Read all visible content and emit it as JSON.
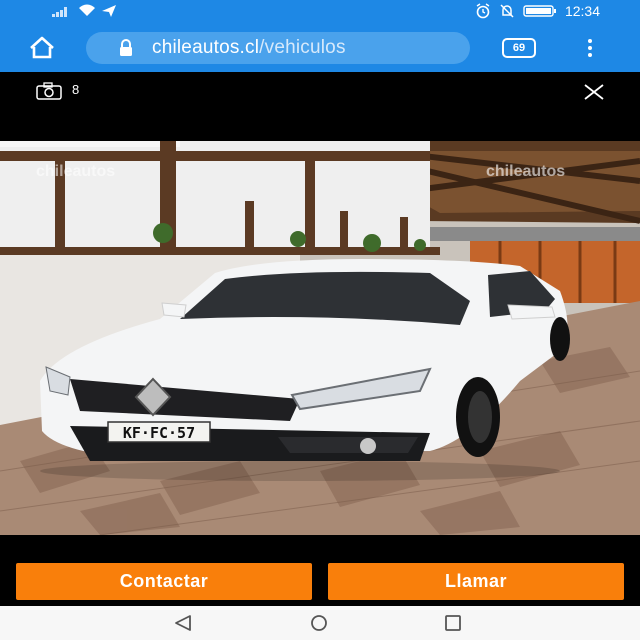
{
  "status_bar": {
    "time": "12:34"
  },
  "browser": {
    "url_host": "chileautos.cl",
    "url_path": "/vehiculos",
    "tab_count": "69"
  },
  "gallery": {
    "photo_count": "8",
    "watermark_text": "chileautos",
    "license_plate": "KF·FC·57"
  },
  "actions": {
    "contact_label": "Contactar",
    "call_label": "Llamar"
  },
  "colors": {
    "browser_blue": "#1e88e5",
    "button_orange": "#f97f0b"
  },
  "icons": [
    "signal-icon",
    "wifi-icon",
    "send-icon",
    "alarm-icon",
    "mute-icon",
    "battery-icon",
    "home-icon",
    "lock-icon",
    "tabs-icon",
    "menu-icon",
    "camera-icon",
    "close-icon",
    "back-icon",
    "circle-home-icon",
    "recent-apps-icon"
  ]
}
